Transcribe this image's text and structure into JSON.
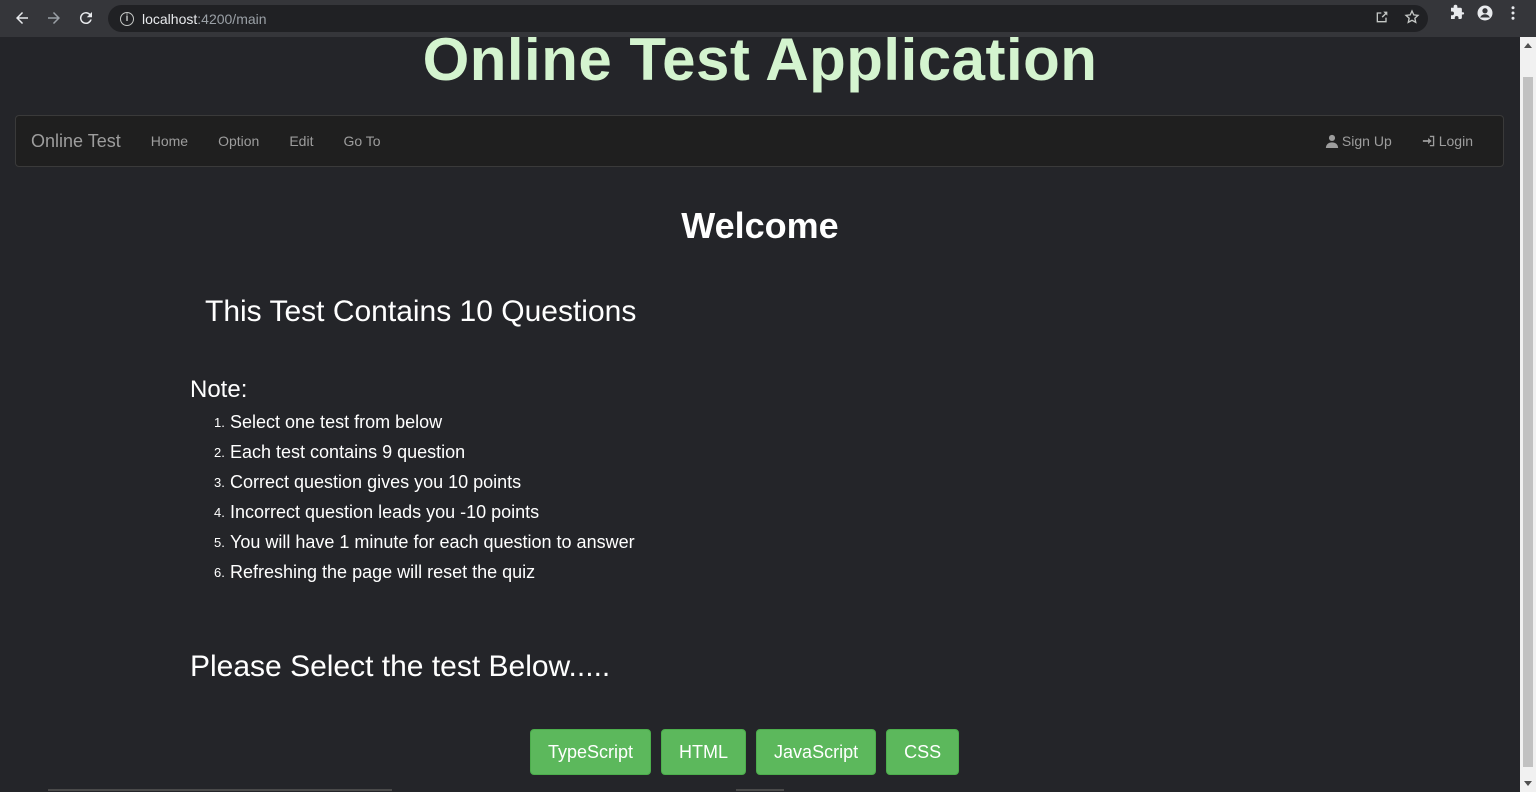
{
  "browser": {
    "url_host": "localhost",
    "url_path": ":4200/main"
  },
  "app": {
    "title": "Online Test Application"
  },
  "navbar": {
    "brand": "Online Test",
    "links": [
      "Home",
      "Option",
      "Edit",
      "Go To"
    ],
    "signup_label": "Sign Up",
    "login_label": "Login"
  },
  "main": {
    "welcome": "Welcome",
    "contains": "This Test Contains 10 Questions",
    "note_label": "Note:",
    "rules": [
      "Select one test from below",
      "Each test contains 9 question",
      "Correct question gives you 10 points",
      "Incorrect question leads you -10 points",
      "You will have 1 minute for each question to answer",
      "Refreshing the page will reset the quiz"
    ],
    "rule_numbers": [
      "1.",
      "2.",
      "3.",
      "4.",
      "5.",
      "6."
    ],
    "select_heading": "Please Select the test Below.....",
    "tests": [
      "TypeScript",
      "HTML",
      "JavaScript",
      "CSS"
    ]
  },
  "colors": {
    "title_green": "#d4f4cf",
    "button_green": "#5cb85c",
    "background": "#242529"
  }
}
